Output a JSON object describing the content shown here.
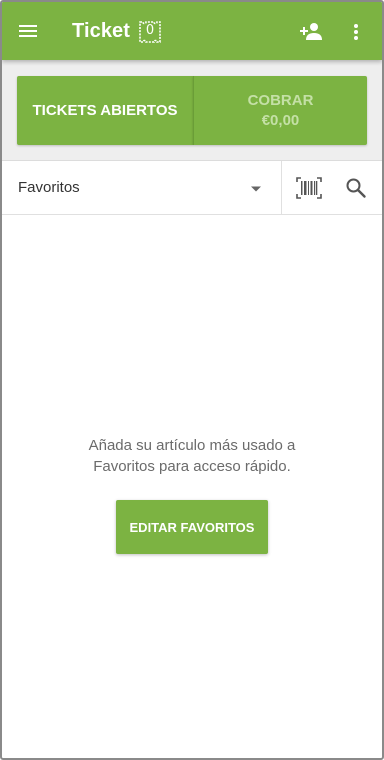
{
  "colors": {
    "primary": "#7cb342",
    "primary_text": "#ffffff",
    "disabled_text": "#c4e0a6",
    "body_text": "#6b6b6b"
  },
  "appbar": {
    "title": "Ticket",
    "ticket_count": "0",
    "icons": [
      "menu-icon",
      "ticket-icon",
      "add-customer-icon",
      "more-vert-icon"
    ]
  },
  "actions": {
    "open_tickets_label": "TICKETS ABIERTOS",
    "charge_label": "COBRAR",
    "charge_amount": "€0,00"
  },
  "filter": {
    "selected_category": "Favoritos",
    "icons": [
      "dropdown-arrow-icon",
      "barcode-icon",
      "search-icon"
    ]
  },
  "empty_state": {
    "message_line1": "Añada su artículo más usado a",
    "message_line2": "Favoritos para acceso rápido.",
    "button_label": "EDITAR FAVORITOS"
  }
}
